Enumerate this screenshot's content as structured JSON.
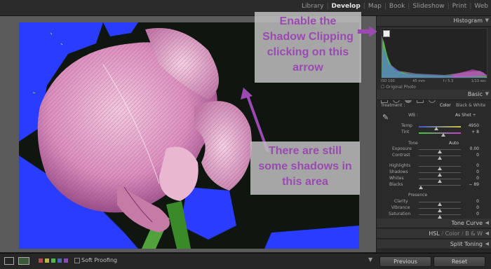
{
  "modules": [
    {
      "label": "Library",
      "active": false
    },
    {
      "label": "Develop",
      "active": true
    },
    {
      "label": "Map",
      "active": false
    },
    {
      "label": "Book",
      "active": false
    },
    {
      "label": "Slideshow",
      "active": false
    },
    {
      "label": "Print",
      "active": false
    },
    {
      "label": "Web",
      "active": false
    }
  ],
  "histogram": {
    "title": "Histogram",
    "iso": "ISO 100",
    "focal": "45 mm",
    "aperture": "f / 5.3",
    "shutter": "1/13 sec",
    "original_photo": "Original Photo"
  },
  "basic": {
    "title": "Basic",
    "treatment_label": "Treatment :",
    "color": "Color",
    "bw": "Black & White",
    "wb_label": "WB :",
    "wb_value": "As Shot ÷",
    "temp_label": "Temp",
    "temp_value": "4950",
    "tint_label": "Tint",
    "tint_value": "+ 8",
    "tone_label": "Tone",
    "auto": "Auto",
    "exposure_label": "Exposure",
    "exposure_value": "0.00",
    "contrast_label": "Contrast",
    "contrast_value": "0",
    "highlights_label": "Highlights",
    "highlights_value": "0",
    "shadows_label": "Shadows",
    "shadows_value": "0",
    "whites_label": "Whites",
    "whites_value": "0",
    "blacks_label": "Blacks",
    "blacks_value": "− 89",
    "presence_label": "Presence",
    "clarity_label": "Clarity",
    "clarity_value": "0",
    "vibrance_label": "Vibrance",
    "vibrance_value": "0",
    "saturation_label": "Saturation",
    "saturation_value": "0"
  },
  "panels": {
    "tone_curve": "Tone Curve",
    "hsl": "HSL",
    "color": "Color",
    "bw": "B & W",
    "split_toning": "Split Toning"
  },
  "toolbar": {
    "soft_proofing": "Soft Proofing",
    "previous": "Previous",
    "reset": "Reset"
  },
  "callouts": {
    "top_lines": [
      "Enable the",
      "Shadow Clipping",
      "clicking on this",
      "arrow"
    ],
    "bottom_lines": [
      "There are still",
      "some shadows in",
      "this area"
    ]
  },
  "colors": {
    "accent_purple": "#9b4ab4",
    "clipping_blue": "#2a3cff",
    "panel_bg": "#2a2a2a"
  },
  "icons": {
    "histogram_arrow": "shadow-clipping-arrow-icon",
    "white_balance": "eyedropper-icon"
  }
}
